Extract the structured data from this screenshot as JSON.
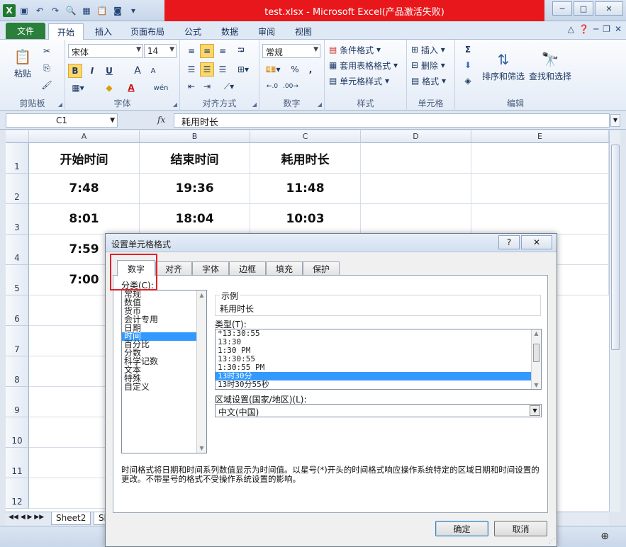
{
  "window": {
    "title": "test.xlsx - Microsoft Excel(产品激活失败)",
    "min": "─",
    "max": "□",
    "close": "✕"
  },
  "ribbon_tabs": [
    "文件",
    "开始",
    "插入",
    "页面布局",
    "公式",
    "数据",
    "审阅",
    "视图"
  ],
  "ribbon": {
    "clipboard": {
      "label": "剪贴板",
      "paste": "粘贴"
    },
    "font": {
      "label": "字体",
      "name": "宋体",
      "size": "14",
      "bold": "B",
      "italic": "I",
      "underline": "U",
      "grow": "A",
      "shrink": "A",
      "color": "A",
      "phonetic": "wén"
    },
    "alignment": {
      "label": "对齐方式"
    },
    "number": {
      "label": "数字",
      "format": "常规",
      "percent": "%",
      "comma": ","
    },
    "styles": {
      "label": "样式",
      "cond": "条件格式",
      "table": "套用表格格式",
      "cell": "单元格样式"
    },
    "cells": {
      "label": "单元格",
      "insert": "插入",
      "delete": "删除",
      "format": "格式"
    },
    "editing": {
      "label": "编辑",
      "sum": "Σ",
      "sort": "排序和筛选",
      "find": "查找和选择"
    }
  },
  "formula_bar": {
    "name_box": "C1",
    "fx": "fx",
    "content": "耗用时长"
  },
  "sheet": {
    "columns": [
      "A",
      "B",
      "C",
      "D",
      "E"
    ],
    "rows": [
      "1",
      "2",
      "3",
      "4",
      "5",
      "6",
      "7",
      "8",
      "9",
      "10",
      "11",
      "12"
    ],
    "cells": [
      [
        "开始时间",
        "结束时间",
        "耗用时长"
      ],
      [
        "7:48",
        "19:36",
        "11:48"
      ],
      [
        "8:01",
        "18:04",
        "10:03"
      ],
      [
        "7:59",
        "",
        ""
      ],
      [
        "7:00",
        "",
        ""
      ]
    ],
    "tabs": [
      "Sheet2",
      "Sh"
    ]
  },
  "dialog": {
    "title": "设置单元格格式",
    "help": "?",
    "close": "✕",
    "tabs": [
      "数字",
      "对齐",
      "字体",
      "边框",
      "填充",
      "保护"
    ],
    "category_label": "分类(C):",
    "categories": [
      "常规",
      "数值",
      "货币",
      "会计专用",
      "日期",
      "时间",
      "百分比",
      "分数",
      "科学记数",
      "文本",
      "特殊",
      "自定义"
    ],
    "selected_category": 5,
    "sample_label": "示例",
    "sample_value": "耗用时长",
    "type_label": "类型(T):",
    "types": [
      "*13:30:55",
      "13:30",
      "1:30 PM",
      "13:30:55",
      "1:30:55 PM",
      "13时30分",
      "13时30分55秒"
    ],
    "selected_type": 5,
    "locale_label": "区域设置(国家/地区)(L):",
    "locale_value": "中文(中国)",
    "description": "时间格式将日期和时间系列数值显示为时间值。以星号(*)开头的时间格式响应操作系统特定的区域日期和时间设置的更改。不带星号的格式不受操作系统设置的影响。",
    "ok": "确定",
    "cancel": "取消"
  }
}
